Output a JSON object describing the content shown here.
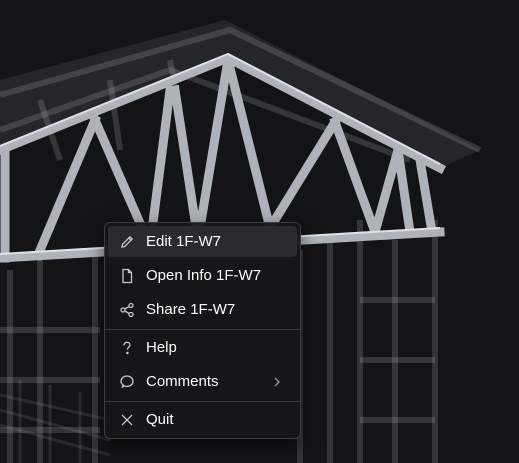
{
  "context_menu": {
    "items": [
      {
        "label": "Edit 1F-W7",
        "icon": "pencil-icon"
      },
      {
        "label": "Open Info 1F-W7",
        "icon": "document-icon"
      },
      {
        "label": "Share 1F-W7",
        "icon": "share-icon"
      },
      {
        "label": "Help",
        "icon": "question-icon"
      },
      {
        "label": "Comments",
        "icon": "comment-icon",
        "submenu": "chevron-right-icon"
      },
      {
        "label": "Quit",
        "icon": "close-icon"
      }
    ]
  },
  "colors": {
    "background": "#141416",
    "truss_member": "#aeb3ba",
    "menu_background": "#161618",
    "menu_highlight": "#2b2b2e",
    "menu_text": "#ffffff"
  }
}
